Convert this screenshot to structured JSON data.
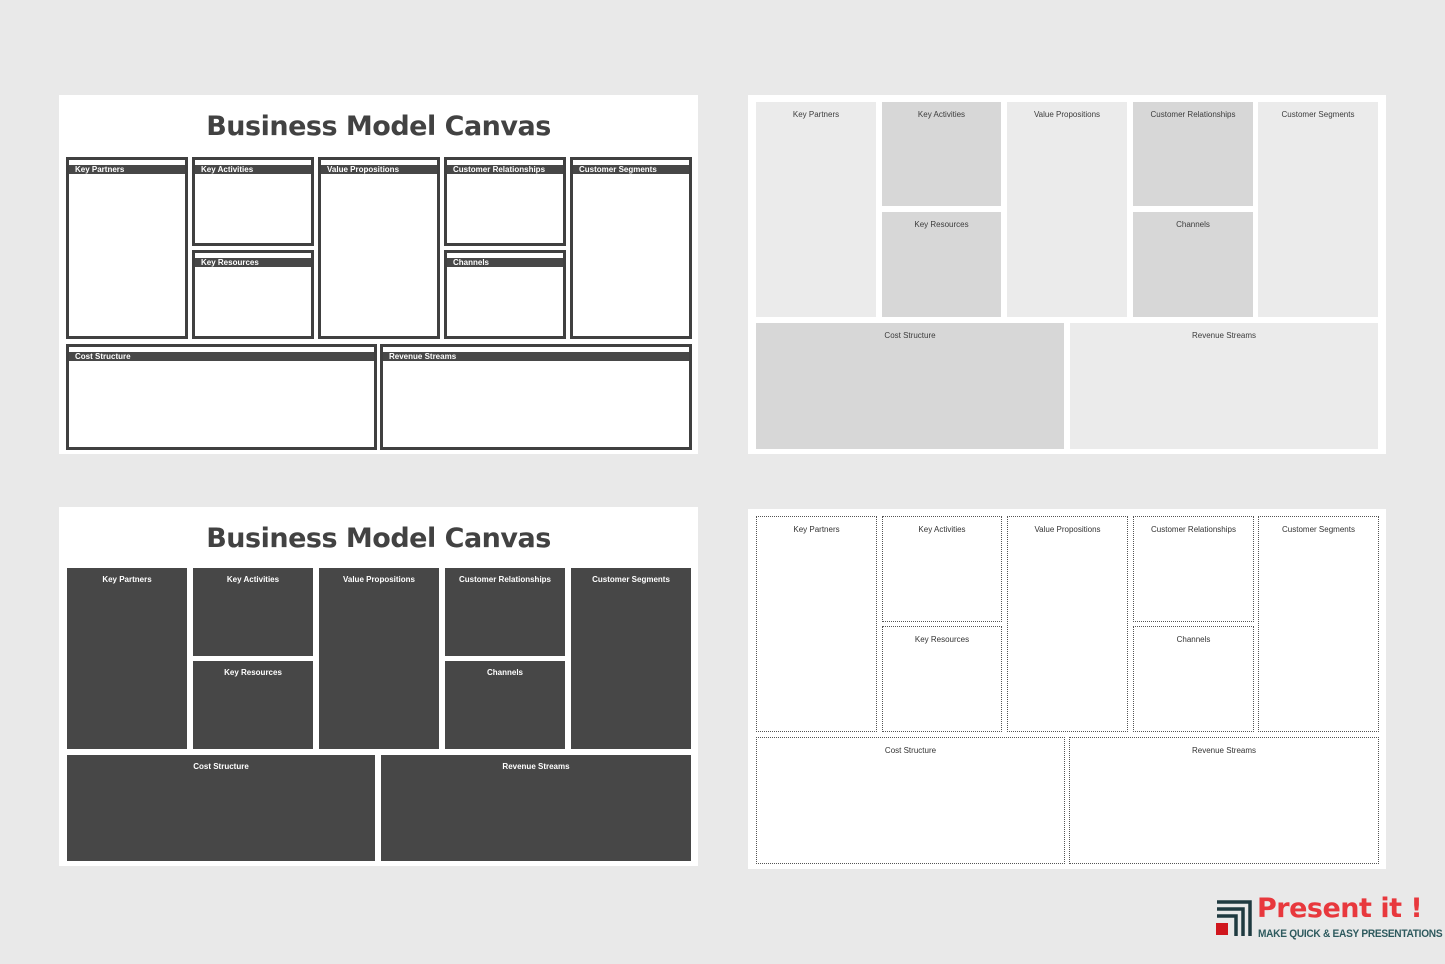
{
  "slides": [
    {
      "title": "Business Model Canvas",
      "style": "outlined-with-header-bar",
      "blocks": {
        "key_partners": "Key Partners",
        "key_activities": "Key Activities",
        "key_resources": "Key Resources",
        "value_propositions": "Value Propositions",
        "customer_relationships": "Customer Relationships",
        "channels": "Channels",
        "customer_segments": "Customer Segments",
        "cost_structure": "Cost Structure",
        "revenue_streams": "Revenue Streams"
      }
    },
    {
      "title": "",
      "style": "light-grey-fill",
      "blocks": {
        "key_partners": "Key Partners",
        "key_activities": "Key Activities",
        "key_resources": "Key Resources",
        "value_propositions": "Value Propositions",
        "customer_relationships": "Customer Relationships",
        "channels": "Channels",
        "customer_segments": "Customer Segments",
        "cost_structure": "Cost Structure",
        "revenue_streams": "Revenue Streams"
      }
    },
    {
      "title": "Business Model Canvas",
      "style": "dark-fill",
      "blocks": {
        "key_partners": "Key Partners",
        "key_activities": "Key Activities",
        "key_resources": "Key Resources",
        "value_propositions": "Value Propositions",
        "customer_relationships": "Customer Relationships",
        "channels": "Channels",
        "customer_segments": "Customer Segments",
        "cost_structure": "Cost Structure",
        "revenue_streams": "Revenue Streams"
      }
    },
    {
      "title": "",
      "style": "dotted-outline",
      "blocks": {
        "key_partners": "Key Partners",
        "key_activities": "Key Activities",
        "key_resources": "Key Resources",
        "value_propositions": "Value Propositions",
        "customer_relationships": "Customer Relationships",
        "channels": "Channels",
        "customer_segments": "Customer Segments",
        "cost_structure": "Cost Structure",
        "revenue_streams": "Revenue Streams"
      }
    }
  ],
  "branding": {
    "name": "Present it !",
    "tagline": "MAKE QUICK & EASY PRESENTATIONS",
    "icon": "stacked-corner-bars-icon",
    "colors": {
      "primary": "#e8383d",
      "secondary": "#1f3a40",
      "tagline": "#2e5a5e"
    }
  },
  "colors": {
    "background": "#e9e9e9",
    "dark_panel": "#474747",
    "light_panel": "#ebebeb",
    "mid_panel": "#d7d7d7"
  }
}
